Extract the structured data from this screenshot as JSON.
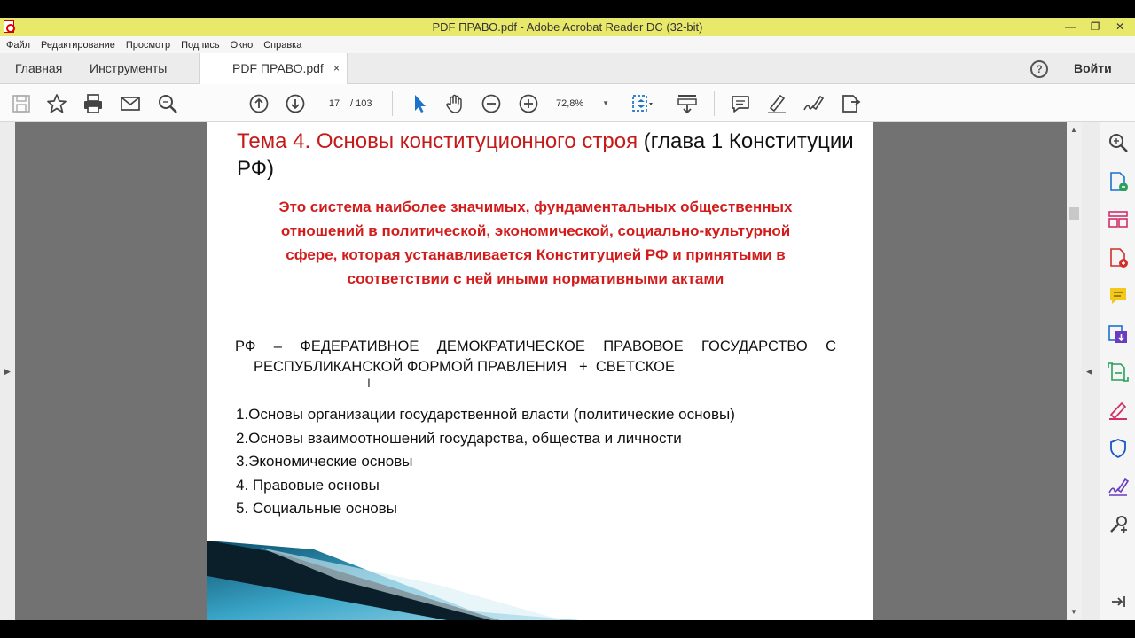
{
  "window": {
    "title": "PDF ПРАВО.pdf - Adobe Acrobat Reader DC (32-bit)"
  },
  "menu": [
    "Файл",
    "Редактирование",
    "Просмотр",
    "Подпись",
    "Окно",
    "Справка"
  ],
  "tabs": {
    "home": "Главная",
    "tools": "Инструменты",
    "document": "PDF ПРАВО.pdf",
    "close_glyph": "×",
    "signin": "Войти"
  },
  "toolbar": {
    "page_current": "17",
    "page_total": "/  103",
    "zoom": "72,8%"
  },
  "slide": {
    "title_red": "Тема 4. Основы конституционного строя",
    "title_rest": " (глава 1 Конституции РФ)",
    "definition": "Это система наиболее значимых, фундаментальных общественных отношений в политической, экономической, социально-культурной сфере, которая устанавливается Конституцией РФ и принятыми в соответствии с ней иными нормативными актами",
    "rf_line1": "РФ – ФЕДЕРАТИВНОЕ ДЕМОКРАТИЧЕСКОЕ ПРАВОВОЕ ГОСУДАРСТВО С",
    "rf_line2": "РЕСПУБЛИКАНСКОЙ ФОРМОЙ ПРАВЛЕНИЯ   +  СВЕТСКОЕ",
    "list": [
      "1.Основы организации государственной власти (политические основы)",
      "2.Основы взаимоотношений государства, общества и личности",
      "3.Экономические основы",
      "4. Правовые основы",
      "5. Социальные основы"
    ]
  },
  "colors": {
    "titlebar": "#e8e86a",
    "accent_red": "#c41a1a",
    "doc_background": "#727272",
    "toolbar_blue": "#1a73c9"
  },
  "icons": {
    "toolbar": [
      "save-icon",
      "star-icon",
      "print-icon",
      "mail-icon",
      "search-icon",
      "page-up-icon",
      "page-down-icon",
      "select-arrow-icon",
      "hand-icon",
      "zoom-out-icon",
      "zoom-in-icon",
      "fit-page-icon",
      "scroll-mode-icon",
      "comment-icon",
      "highlight-icon",
      "sign-icon",
      "share-icon"
    ],
    "right_pane": [
      "search-icon",
      "export-pdf-icon",
      "organize-pages-icon",
      "create-pdf-icon",
      "comment-icon",
      "send-icon",
      "scan-icon",
      "fill-sign-icon",
      "protect-icon",
      "sign-icon",
      "more-tools-icon",
      "collapse-icon"
    ]
  }
}
